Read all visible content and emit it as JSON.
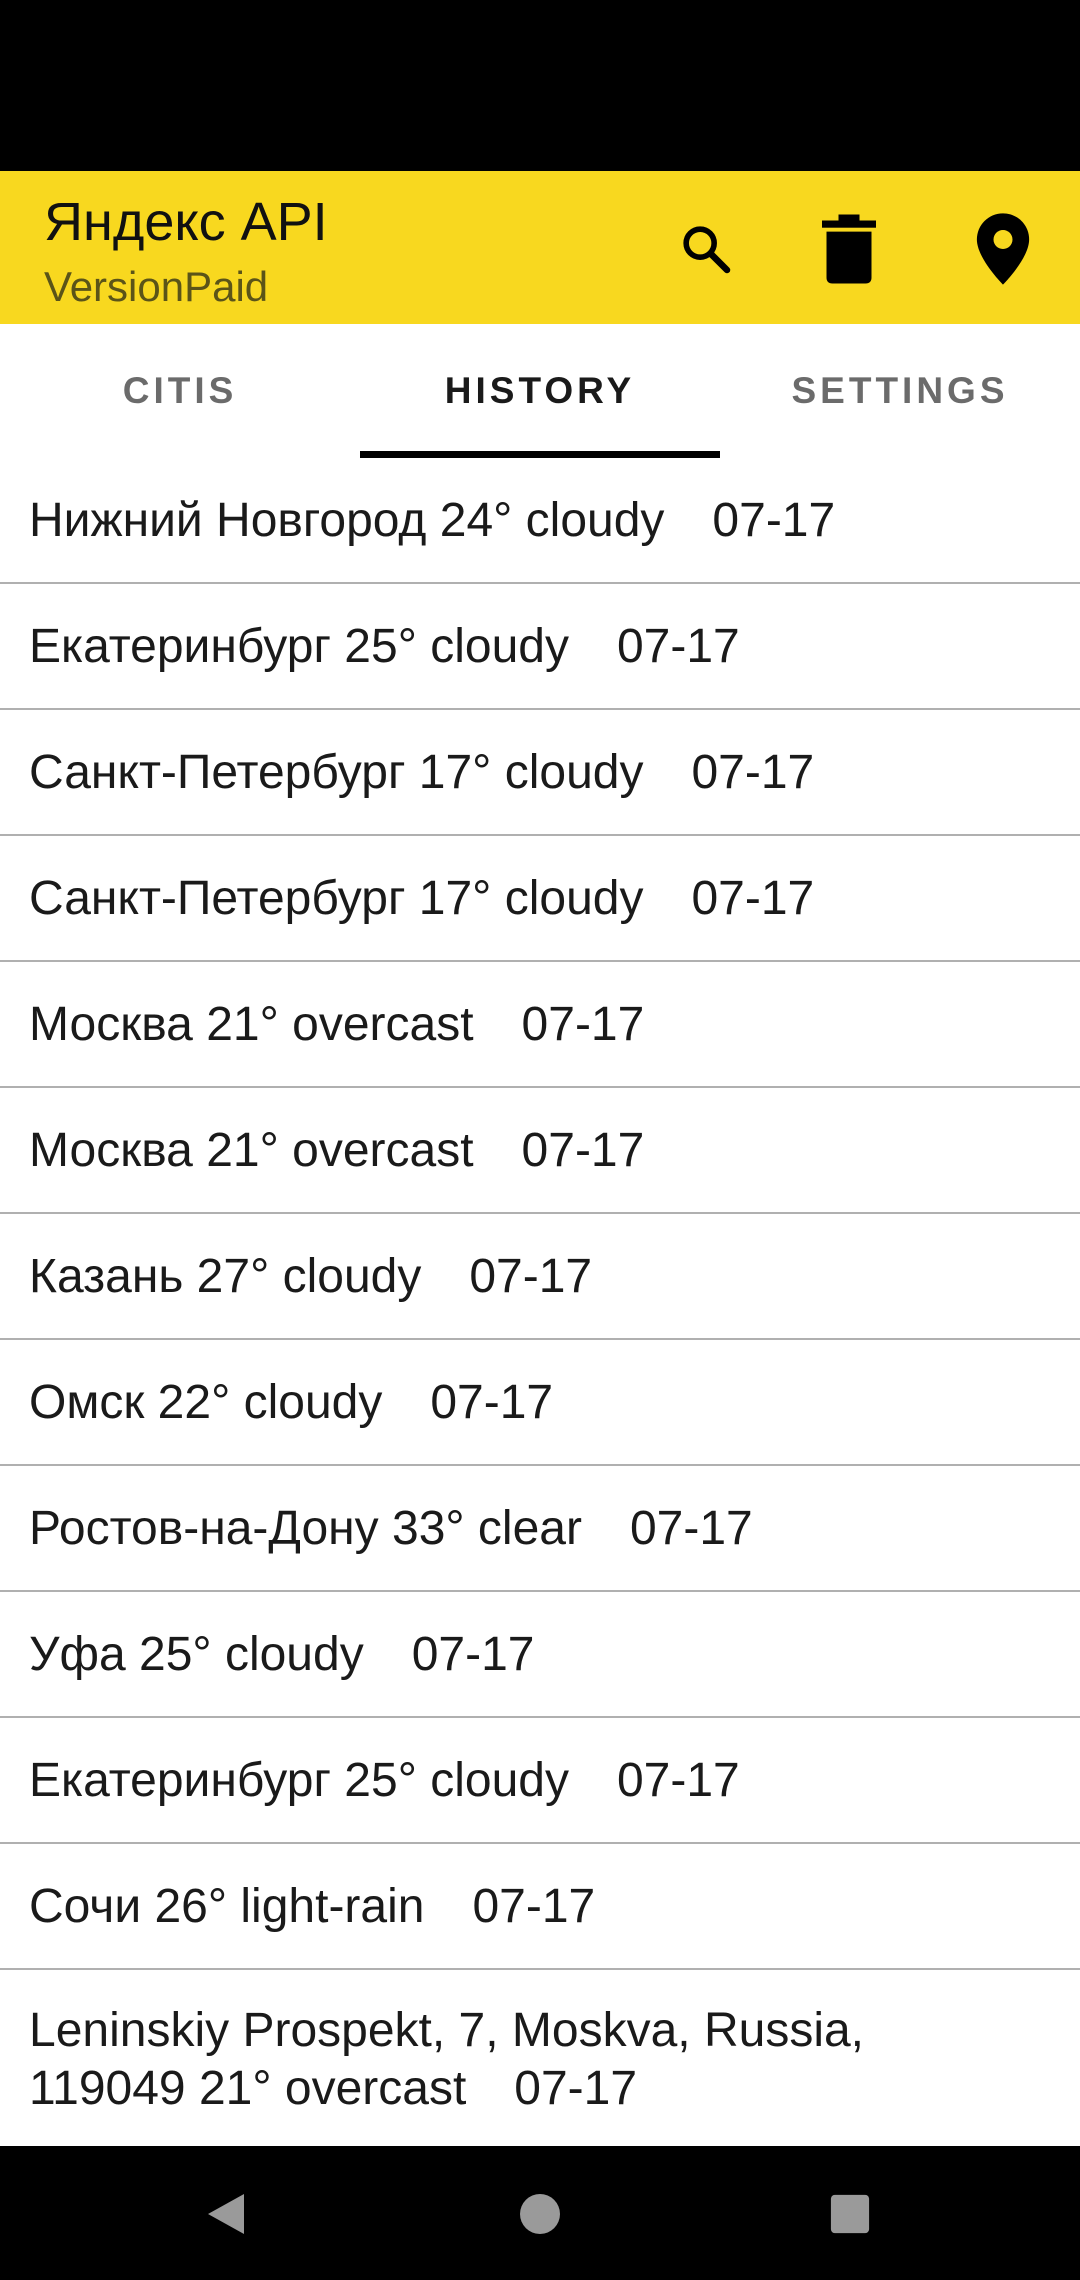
{
  "app_bar": {
    "title": "Яндекс API",
    "subtitle": "VersionPaid",
    "background": "#F8D81F",
    "actions": [
      {
        "icon": "search-icon"
      },
      {
        "icon": "trash-icon"
      },
      {
        "icon": "location-pin-icon"
      }
    ]
  },
  "tabs": [
    {
      "label": "CITIS",
      "active": false
    },
    {
      "label": "HISTORY",
      "active": true
    },
    {
      "label": "SETTINGS",
      "active": false
    }
  ],
  "history": [
    {
      "text": "Нижний Новгород 24° cloudy",
      "date": "07-17"
    },
    {
      "text": "Екатеринбург 25° cloudy",
      "date": "07-17"
    },
    {
      "text": "Санкт-Петербург 17° cloudy",
      "date": "07-17"
    },
    {
      "text": "Санкт-Петербург 17° cloudy",
      "date": "07-17"
    },
    {
      "text": "Москва 21° overcast",
      "date": "07-17"
    },
    {
      "text": "Москва 21° overcast",
      "date": "07-17"
    },
    {
      "text": "Казань 27° cloudy",
      "date": "07-17"
    },
    {
      "text": "Омск 22° cloudy",
      "date": "07-17"
    },
    {
      "text": "Ростов-на-Дону 33° clear",
      "date": "07-17"
    },
    {
      "text": "Уфа 25° cloudy",
      "date": "07-17"
    },
    {
      "text": "Екатеринбург 25° cloudy",
      "date": "07-17"
    },
    {
      "text": "Сочи 26° light-rain",
      "date": "07-17"
    },
    {
      "text": "Leninskiy Prospekt, 7, Moskva, Russia, 119049 21° overcast",
      "date": "07-17"
    }
  ],
  "system_nav": {
    "icons": [
      "back-icon",
      "home-icon",
      "recents-icon"
    ]
  }
}
